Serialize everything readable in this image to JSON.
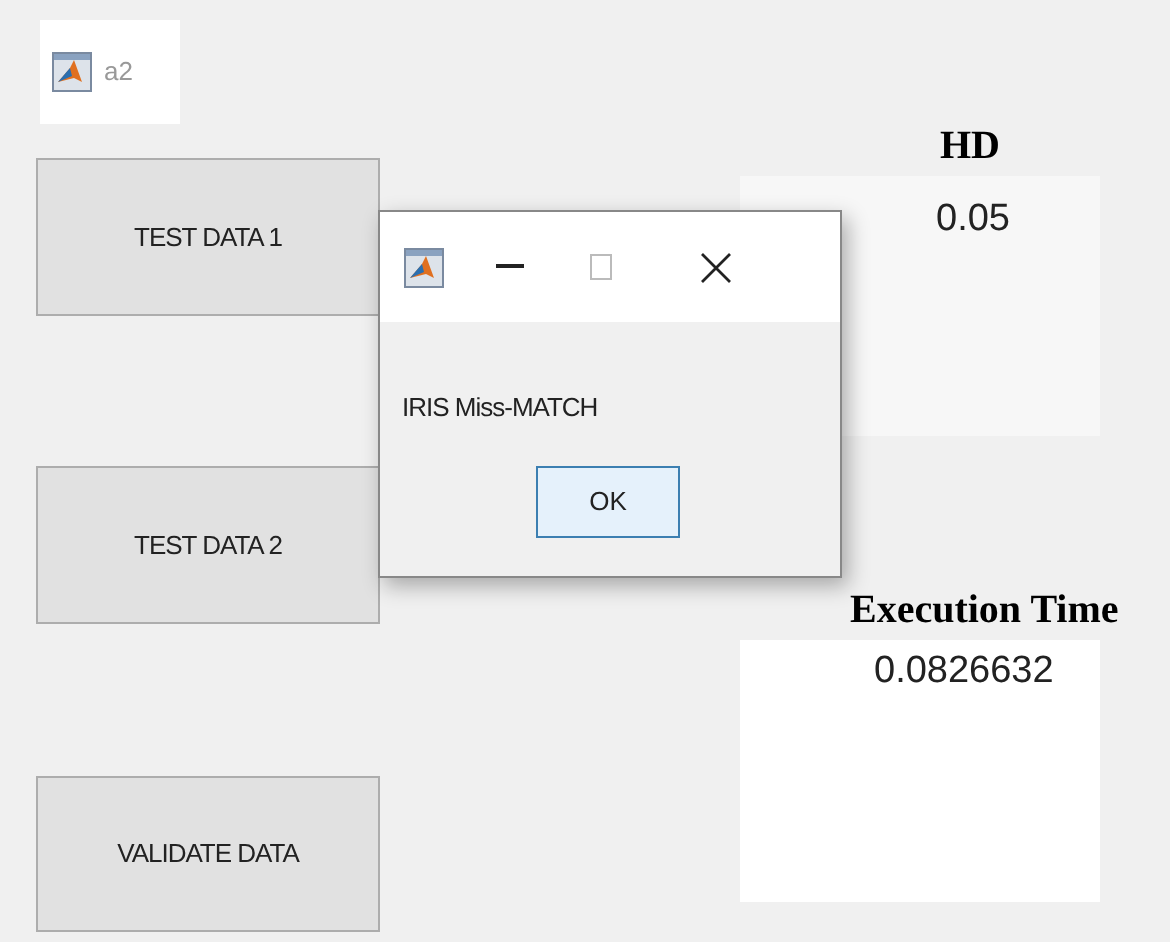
{
  "window": {
    "title": "a2"
  },
  "buttons": [
    {
      "label": "TEST DATA 1"
    },
    {
      "label": "TEST DATA 2"
    },
    {
      "label": "VALIDATE DATA"
    }
  ],
  "results": [
    {
      "heading": "HD",
      "value": "0.05"
    },
    {
      "heading": "Execution Time",
      "value": "0.0826632"
    }
  ],
  "dialog": {
    "message": "IRIS Miss-MATCH",
    "button": "OK"
  }
}
